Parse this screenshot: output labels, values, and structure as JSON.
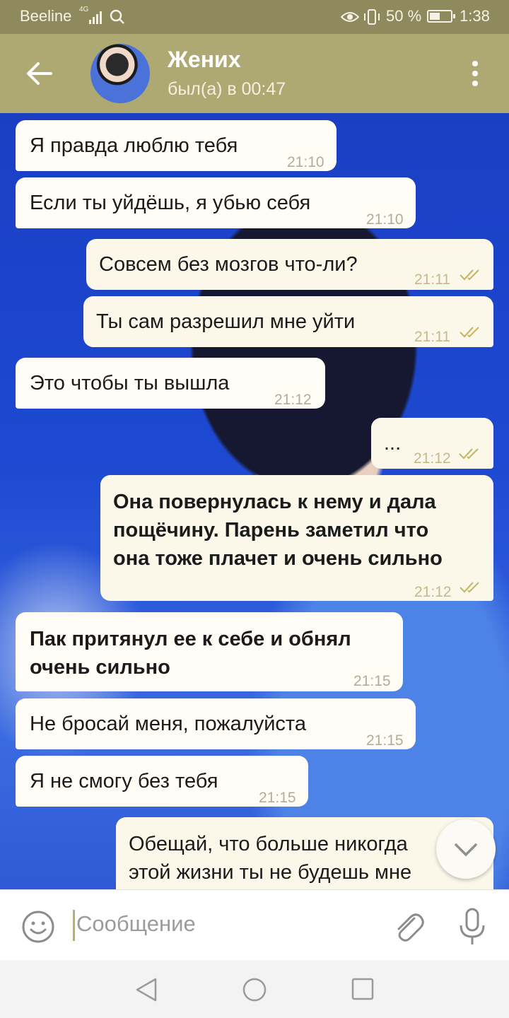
{
  "status_bar": {
    "carrier": "Beeline",
    "network": "4G",
    "battery": "50 %",
    "battery_level": 0.5,
    "time": "1:38",
    "icons": [
      "signal-icon",
      "search-icon",
      "eye-icon",
      "vibrate-icon",
      "battery-icon"
    ]
  },
  "header": {
    "title": "Жених",
    "subtitle": "был(а) в 00:47",
    "icons": [
      "back-arrow-icon",
      "avatar",
      "more-vert-icon"
    ]
  },
  "messages": [
    {
      "dir": "in",
      "text": "Я правда люблю тебя",
      "time": "21:10"
    },
    {
      "dir": "in",
      "text": "Если ты уйдёшь, я убью себя",
      "time": "21:10"
    },
    {
      "dir": "out",
      "text": "Совсем без мозгов что-ли?",
      "time": "21:11",
      "read": true
    },
    {
      "dir": "out",
      "text": "Ты сам разрешил мне уйти",
      "time": "21:11",
      "read": true
    },
    {
      "dir": "in",
      "text": "Это чтобы ты вышла",
      "time": "21:12"
    },
    {
      "dir": "out",
      "text": "...",
      "time": "21:12",
      "read": true
    },
    {
      "dir": "out",
      "lines": [
        "Она повернулась к нему и дала",
        "пощёчину. Парень заметил что",
        "она тоже плачет и очень сильно"
      ],
      "time": "21:12",
      "read": true,
      "bold": true
    },
    {
      "dir": "in",
      "lines": [
        "Пак притянул ее к себе и обнял",
        "очень сильно"
      ],
      "time": "21:15",
      "bold": true
    },
    {
      "dir": "in",
      "text": "Не бросай меня, пожалуйста",
      "time": "21:15"
    },
    {
      "dir": "in",
      "text": "Я не смогу без тебя",
      "time": "21:15"
    },
    {
      "dir": "out",
      "lines": [
        "Обещай, что больше никогда",
        "этой жизни ты не будешь мне"
      ]
    }
  ],
  "input": {
    "placeholder": "Сообщение",
    "icons": [
      "emoji-icon",
      "attach-icon",
      "microphone-icon",
      "chevron-down-icon"
    ]
  },
  "nav_bar": {
    "icons": [
      "back-triangle-icon",
      "home-circle-icon",
      "recents-square-icon"
    ]
  },
  "colors": {
    "status_bar": "#8f8a5e",
    "header": "#aea872",
    "bubble_in": "#fffdf5",
    "bubble_out": "#fbf8ea",
    "read_ticks": "#c8b86a",
    "wallpaper": "#1d49d2"
  }
}
